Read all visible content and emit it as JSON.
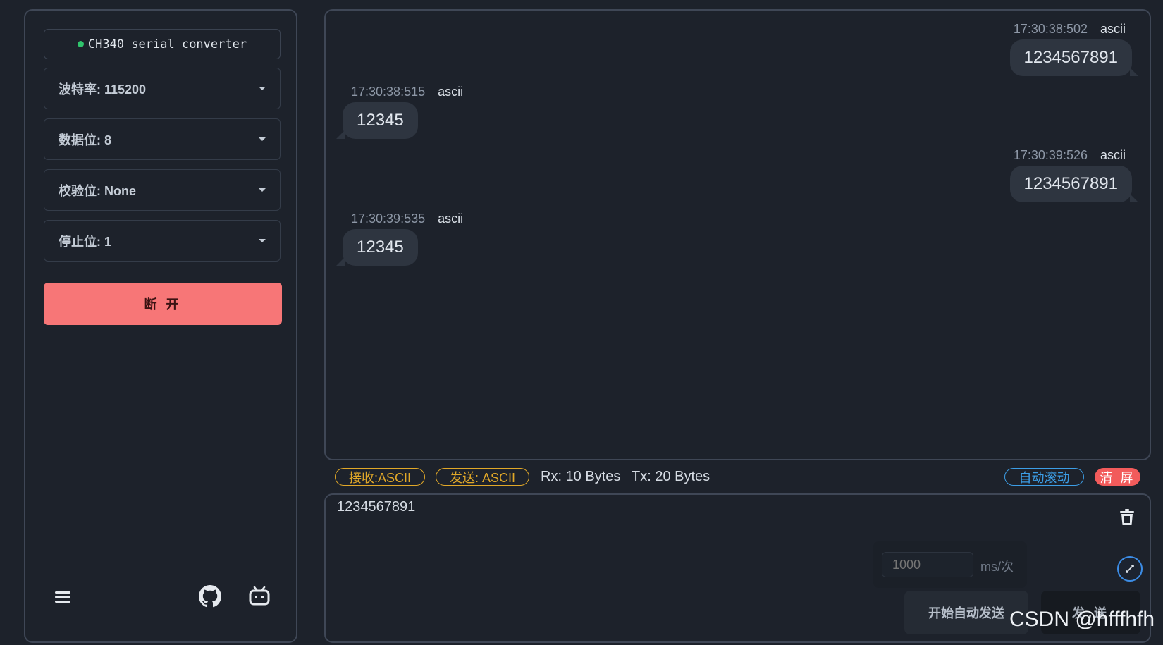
{
  "sidebar": {
    "port": {
      "name": "CH340 serial converter",
      "status_color": "#2fc46c"
    },
    "selects": [
      {
        "label": "波特率: 115200"
      },
      {
        "label": "数据位: 8"
      },
      {
        "label": "校验位: None"
      },
      {
        "label": "停止位: 1"
      }
    ],
    "disconnect_label": "断 开",
    "bottom_icons": [
      "menu-icon",
      "github-icon",
      "bilibili-icon"
    ]
  },
  "messages": [
    {
      "direction": "sent",
      "time": "17:30:38:502",
      "encoding": "ascii",
      "text": "1234567891"
    },
    {
      "direction": "received",
      "time": "17:30:38:515",
      "encoding": "ascii",
      "text": "12345"
    },
    {
      "direction": "sent",
      "time": "17:30:39:526",
      "encoding": "ascii",
      "text": "1234567891"
    },
    {
      "direction": "received",
      "time": "17:30:39:535",
      "encoding": "ascii",
      "text": "12345"
    }
  ],
  "statusbar": {
    "rx_mode": "接收:ASCII",
    "tx_mode": "发送: ASCII",
    "rx_count": "Rx: 10 Bytes",
    "tx_count": "Tx: 20 Bytes",
    "auto_scroll": "自动滚动",
    "clear": "清 屏"
  },
  "input": {
    "value": "1234567891",
    "interval_placeholder": "1000",
    "interval_unit": "ms/次",
    "auto_send_label": "开始自动发送",
    "send_label": "发 送"
  },
  "watermark": "CSDN @hfffhfh",
  "colors": {
    "background": "#1d222b",
    "accent_red": "#f77677",
    "accent_yellow": "#e1a828",
    "accent_blue": "#3c9ee6",
    "bubble": "#2e3540"
  }
}
